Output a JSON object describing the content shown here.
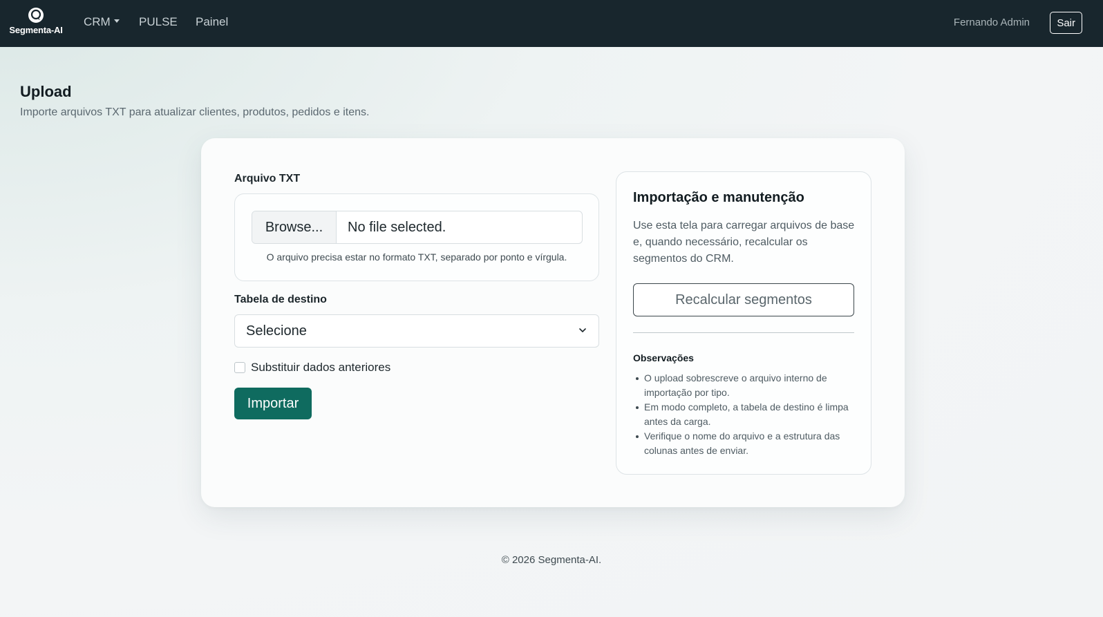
{
  "navbar": {
    "brand": "Segmenta-AI",
    "links": [
      {
        "label": "CRM",
        "has_dropdown": true
      },
      {
        "label": "PULSE"
      },
      {
        "label": "Painel"
      }
    ],
    "user": "Fernando Admin",
    "logout_label": "Sair"
  },
  "header": {
    "title": "Upload",
    "subtitle": "Importe arquivos TXT para atualizar clientes, produtos, pedidos e itens."
  },
  "form": {
    "file_label": "Arquivo TXT",
    "browse_label": "Browse...",
    "file_status": "No file selected.",
    "file_hint": "O arquivo precisa estar no formato TXT, separado por ponto e vírgula.",
    "table_label": "Tabela de destino",
    "table_selected": "Selecione",
    "replace_label": "Substituir dados anteriores",
    "replace_checked": false,
    "submit_label": "Importar"
  },
  "side": {
    "title": "Importação e manutenção",
    "text": "Use esta tela para carregar arquivos de base e, quando necessário, recalcular os segmentos do CRM.",
    "recalc_label": "Recalcular segmentos",
    "notes_title": "Observações",
    "notes": [
      "O upload sobrescreve o arquivo interno de importação por tipo.",
      "Em modo completo, a tabela de destino é limpa antes da carga.",
      "Verifique o nome do arquivo e a estrutura das colunas antes de enviar."
    ]
  },
  "footer": "© 2026 Segmenta-AI.",
  "colors": {
    "navbar": "#18262d",
    "primary": "#0f6b5f"
  }
}
